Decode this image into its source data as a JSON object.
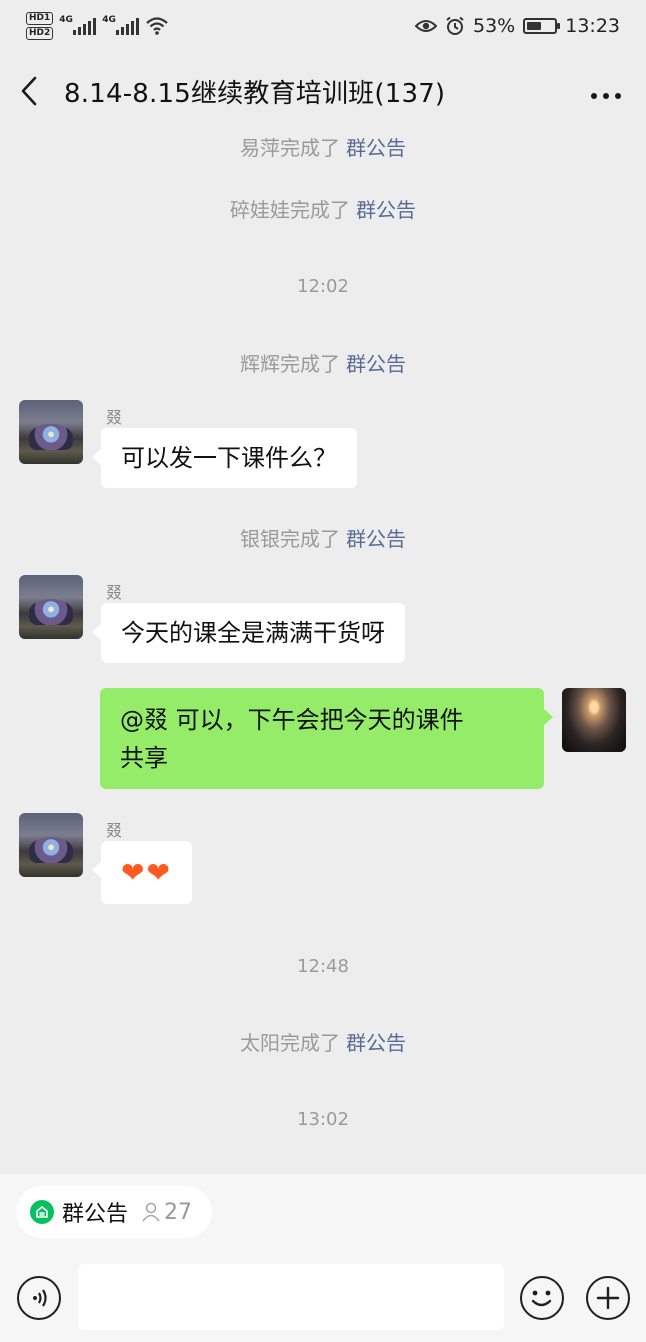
{
  "status_bar": {
    "hd1": "HD1",
    "hd2": "HD2",
    "net1": "4G",
    "net2": "4G",
    "battery_percent": "53%",
    "battery_level": 0.53,
    "time": "13:23"
  },
  "nav": {
    "title": "8.14-8.15继续教育培训班(137)",
    "back_icon": "chevron-left",
    "more_icon": "more-dots",
    "more_label": "···"
  },
  "messages": {
    "sys1": {
      "actor": "易萍完成了",
      "link": "群公告"
    },
    "sys2": {
      "actor": "碎娃娃完成了",
      "link": "群公告"
    },
    "time1": "12:02",
    "sys3": {
      "actor": "辉辉完成了",
      "link": "群公告"
    },
    "msg1": {
      "sender": "叕",
      "text": "可以发一下课件么？"
    },
    "sys4": {
      "actor": "银银完成了",
      "link": "群公告"
    },
    "msg2": {
      "sender": "叕",
      "text": "今天的课全是满满干货呀"
    },
    "msg3": {
      "line1": "@叕  可以，下午会把今天的课件",
      "line2": "共享"
    },
    "msg4": {
      "sender": "叕",
      "text": "❤❤"
    },
    "time2": "12:48",
    "sys5": {
      "actor": "太阳完成了",
      "link": "群公告"
    },
    "time3": "13:02"
  },
  "bottom": {
    "notice_label": "群公告",
    "notice_count": "27",
    "input_value": ""
  },
  "colors": {
    "background": "#ededed",
    "self_bubble": "#95ec69",
    "link": "#576b95",
    "notice_green": "#07c160"
  }
}
